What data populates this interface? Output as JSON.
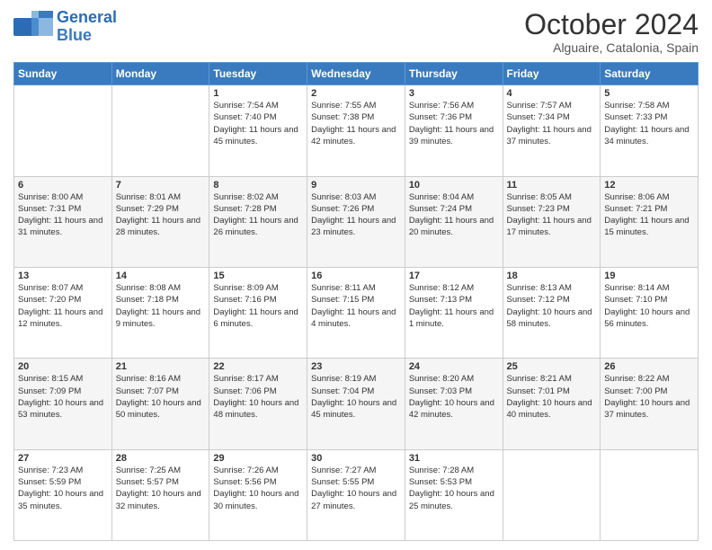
{
  "header": {
    "logo_line1": "General",
    "logo_line2": "Blue",
    "month": "October 2024",
    "location": "Alguaire, Catalonia, Spain"
  },
  "weekdays": [
    "Sunday",
    "Monday",
    "Tuesday",
    "Wednesday",
    "Thursday",
    "Friday",
    "Saturday"
  ],
  "weeks": [
    [
      {
        "day": "",
        "info": ""
      },
      {
        "day": "",
        "info": ""
      },
      {
        "day": "1",
        "info": "Sunrise: 7:54 AM\nSunset: 7:40 PM\nDaylight: 11 hours and 45 minutes."
      },
      {
        "day": "2",
        "info": "Sunrise: 7:55 AM\nSunset: 7:38 PM\nDaylight: 11 hours and 42 minutes."
      },
      {
        "day": "3",
        "info": "Sunrise: 7:56 AM\nSunset: 7:36 PM\nDaylight: 11 hours and 39 minutes."
      },
      {
        "day": "4",
        "info": "Sunrise: 7:57 AM\nSunset: 7:34 PM\nDaylight: 11 hours and 37 minutes."
      },
      {
        "day": "5",
        "info": "Sunrise: 7:58 AM\nSunset: 7:33 PM\nDaylight: 11 hours and 34 minutes."
      }
    ],
    [
      {
        "day": "6",
        "info": "Sunrise: 8:00 AM\nSunset: 7:31 PM\nDaylight: 11 hours and 31 minutes."
      },
      {
        "day": "7",
        "info": "Sunrise: 8:01 AM\nSunset: 7:29 PM\nDaylight: 11 hours and 28 minutes."
      },
      {
        "day": "8",
        "info": "Sunrise: 8:02 AM\nSunset: 7:28 PM\nDaylight: 11 hours and 26 minutes."
      },
      {
        "day": "9",
        "info": "Sunrise: 8:03 AM\nSunset: 7:26 PM\nDaylight: 11 hours and 23 minutes."
      },
      {
        "day": "10",
        "info": "Sunrise: 8:04 AM\nSunset: 7:24 PM\nDaylight: 11 hours and 20 minutes."
      },
      {
        "day": "11",
        "info": "Sunrise: 8:05 AM\nSunset: 7:23 PM\nDaylight: 11 hours and 17 minutes."
      },
      {
        "day": "12",
        "info": "Sunrise: 8:06 AM\nSunset: 7:21 PM\nDaylight: 11 hours and 15 minutes."
      }
    ],
    [
      {
        "day": "13",
        "info": "Sunrise: 8:07 AM\nSunset: 7:20 PM\nDaylight: 11 hours and 12 minutes."
      },
      {
        "day": "14",
        "info": "Sunrise: 8:08 AM\nSunset: 7:18 PM\nDaylight: 11 hours and 9 minutes."
      },
      {
        "day": "15",
        "info": "Sunrise: 8:09 AM\nSunset: 7:16 PM\nDaylight: 11 hours and 6 minutes."
      },
      {
        "day": "16",
        "info": "Sunrise: 8:11 AM\nSunset: 7:15 PM\nDaylight: 11 hours and 4 minutes."
      },
      {
        "day": "17",
        "info": "Sunrise: 8:12 AM\nSunset: 7:13 PM\nDaylight: 11 hours and 1 minute."
      },
      {
        "day": "18",
        "info": "Sunrise: 8:13 AM\nSunset: 7:12 PM\nDaylight: 10 hours and 58 minutes."
      },
      {
        "day": "19",
        "info": "Sunrise: 8:14 AM\nSunset: 7:10 PM\nDaylight: 10 hours and 56 minutes."
      }
    ],
    [
      {
        "day": "20",
        "info": "Sunrise: 8:15 AM\nSunset: 7:09 PM\nDaylight: 10 hours and 53 minutes."
      },
      {
        "day": "21",
        "info": "Sunrise: 8:16 AM\nSunset: 7:07 PM\nDaylight: 10 hours and 50 minutes."
      },
      {
        "day": "22",
        "info": "Sunrise: 8:17 AM\nSunset: 7:06 PM\nDaylight: 10 hours and 48 minutes."
      },
      {
        "day": "23",
        "info": "Sunrise: 8:19 AM\nSunset: 7:04 PM\nDaylight: 10 hours and 45 minutes."
      },
      {
        "day": "24",
        "info": "Sunrise: 8:20 AM\nSunset: 7:03 PM\nDaylight: 10 hours and 42 minutes."
      },
      {
        "day": "25",
        "info": "Sunrise: 8:21 AM\nSunset: 7:01 PM\nDaylight: 10 hours and 40 minutes."
      },
      {
        "day": "26",
        "info": "Sunrise: 8:22 AM\nSunset: 7:00 PM\nDaylight: 10 hours and 37 minutes."
      }
    ],
    [
      {
        "day": "27",
        "info": "Sunrise: 7:23 AM\nSunset: 5:59 PM\nDaylight: 10 hours and 35 minutes."
      },
      {
        "day": "28",
        "info": "Sunrise: 7:25 AM\nSunset: 5:57 PM\nDaylight: 10 hours and 32 minutes."
      },
      {
        "day": "29",
        "info": "Sunrise: 7:26 AM\nSunset: 5:56 PM\nDaylight: 10 hours and 30 minutes."
      },
      {
        "day": "30",
        "info": "Sunrise: 7:27 AM\nSunset: 5:55 PM\nDaylight: 10 hours and 27 minutes."
      },
      {
        "day": "31",
        "info": "Sunrise: 7:28 AM\nSunset: 5:53 PM\nDaylight: 10 hours and 25 minutes."
      },
      {
        "day": "",
        "info": ""
      },
      {
        "day": "",
        "info": ""
      }
    ]
  ]
}
